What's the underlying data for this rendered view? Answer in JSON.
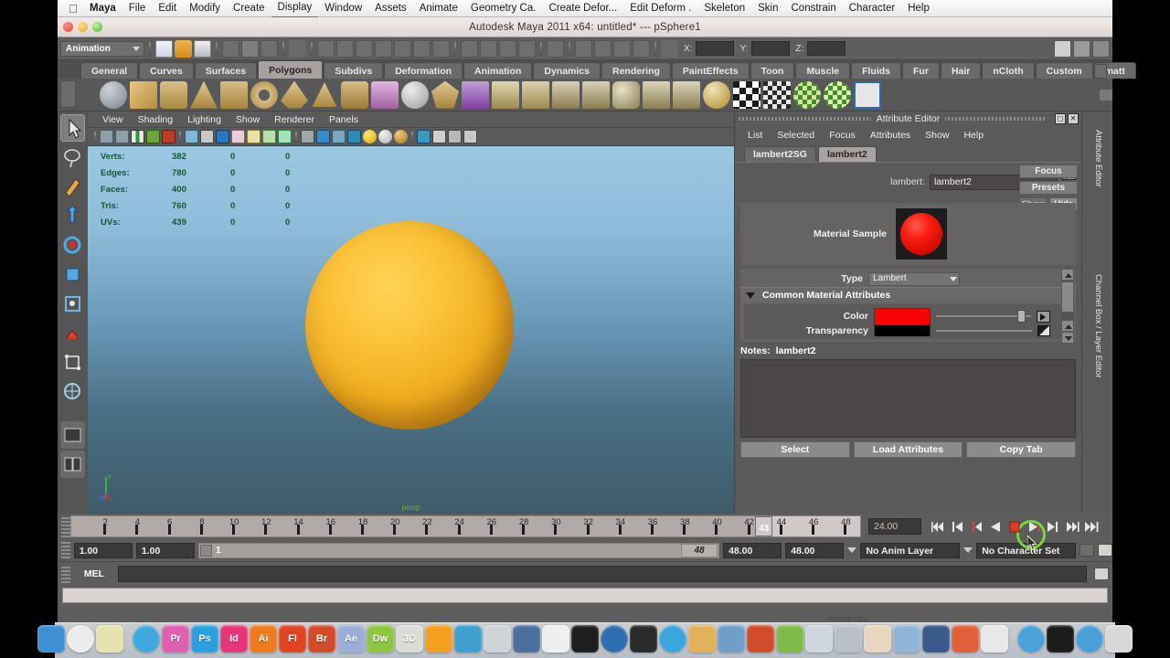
{
  "os_menubar": {
    "apple_icon": "apple-icon",
    "items": [
      {
        "label": "Maya",
        "bold": true,
        "active": false
      },
      {
        "label": "File",
        "bold": false,
        "active": false
      },
      {
        "label": "Edit",
        "bold": false,
        "active": false
      },
      {
        "label": "Modify",
        "bold": false,
        "active": false
      },
      {
        "label": "Create",
        "bold": false,
        "active": false
      },
      {
        "label": "Display",
        "bold": false,
        "active": true
      },
      {
        "label": "Window",
        "bold": false,
        "active": false
      },
      {
        "label": "Assets",
        "bold": false,
        "active": false
      },
      {
        "label": "Animate",
        "bold": false,
        "active": false
      },
      {
        "label": "Geometry Ca.",
        "bold": false,
        "active": false
      },
      {
        "label": "Create Defor...",
        "bold": false,
        "active": false
      },
      {
        "label": "Edit Deform .",
        "bold": false,
        "active": false
      },
      {
        "label": "Skeleton",
        "bold": false,
        "active": false
      },
      {
        "label": "Skin",
        "bold": false,
        "active": false
      },
      {
        "label": "Constrain",
        "bold": false,
        "active": false
      },
      {
        "label": "Character",
        "bold": false,
        "active": false
      },
      {
        "label": "Help",
        "bold": false,
        "active": false
      }
    ]
  },
  "title_bar": {
    "title": "Autodesk Maya 2011 x64: untitled*  ---  pSphere1"
  },
  "status_line": {
    "menu_set": "Animation",
    "x_label": "X:",
    "y_label": "Y:",
    "z_label": "Z:",
    "x_value": "",
    "y_value": "",
    "z_value": ""
  },
  "shelf": {
    "tabs": [
      "General",
      "Curves",
      "Surfaces",
      "Polygons",
      "Subdivs",
      "Deformation",
      "Animation",
      "Dynamics",
      "Rendering",
      "PaintEffects",
      "Toon",
      "Muscle",
      "Fluids",
      "Fur",
      "Hair",
      "nCloth",
      "Custom",
      "matt"
    ],
    "selected_tab": "Polygons"
  },
  "viewport": {
    "menus": [
      "View",
      "Shading",
      "Lighting",
      "Show",
      "Renderer",
      "Panels"
    ],
    "hud": {
      "rows": [
        {
          "label": "Verts:",
          "total": "382",
          "b": "0",
          "c": "0"
        },
        {
          "label": "Edges:",
          "total": "780",
          "b": "0",
          "c": "0"
        },
        {
          "label": "Faces:",
          "total": "400",
          "b": "0",
          "c": "0"
        },
        {
          "label": "Tris:",
          "total": "760",
          "b": "0",
          "c": "0"
        },
        {
          "label": "UVs:",
          "total": "439",
          "b": "0",
          "c": "0"
        }
      ]
    },
    "axis_labels": {
      "y": "y",
      "x": "x",
      "z": "z"
    },
    "camera_label": "persp"
  },
  "attribute_editor": {
    "title": "Attribute Editor",
    "menus": [
      "List",
      "Selected",
      "Focus",
      "Attributes",
      "Show",
      "Help"
    ],
    "tabs": [
      "lambert2SG",
      "lambert2"
    ],
    "selected_tab": "lambert2",
    "name_label": "lambert:",
    "name_value": "lambert2",
    "buttons": {
      "focus": "Focus",
      "presets": "Presets",
      "show": "Show",
      "hide": "Hide"
    },
    "material_sample_label": "Material Sample",
    "material_sample_color": "#fb1c10",
    "type_label": "Type",
    "type_value": "Lambert",
    "section_title": "Common Material Attributes",
    "attributes": [
      {
        "label": "Color",
        "color": "#ff0000"
      },
      {
        "label": "Transparency",
        "color": "#000000"
      }
    ],
    "notes_label": "Notes:",
    "notes_value": "lambert2",
    "notes_text": "",
    "footer_buttons": [
      "Select",
      "Load Attributes",
      "Copy Tab"
    ]
  },
  "right_panel": {
    "label_top": "Attribute Editor",
    "label_bottom": "Channel Box / Layer Editor"
  },
  "time_slider": {
    "ticks": [
      2,
      4,
      6,
      8,
      10,
      12,
      14,
      16,
      18,
      20,
      22,
      24,
      26,
      28,
      30,
      32,
      34,
      36,
      38,
      40,
      42,
      44,
      46,
      48
    ],
    "current_frame": "43",
    "frame_field": "24.00",
    "playback_buttons": [
      "go-to-start-icon",
      "step-back-frame-icon",
      "step-back-key-icon",
      "play-backwards-icon",
      "stop-icon",
      "play-forwards-icon",
      "step-forward-key-icon",
      "step-forward-frame-icon",
      "go-to-end-icon"
    ],
    "active_button": "stop-icon"
  },
  "range_slider": {
    "start_field": "1.00",
    "anim_start_field": "1.00",
    "range_start_label": "1",
    "range_end_label": "48",
    "anim_end_field": "48.00",
    "end_field": "48.00",
    "anim_layer": "No Anim Layer",
    "character_set": "No Character Set"
  },
  "command_line": {
    "label": "MEL",
    "value": ""
  },
  "help_line": {
    "value": ""
  },
  "dock": {
    "user_label": "Alexandru",
    "items": [
      {
        "name": "finder-icon",
        "color": "#3e8fd4",
        "letter": ""
      },
      {
        "name": "launchpad-icon",
        "color": "#ececec",
        "letter": ""
      },
      {
        "name": "notes-icon",
        "color": "#e6e2b0",
        "letter": ""
      },
      {
        "name": "safari-icon",
        "color": "#3fa8dd",
        "letter": ""
      },
      {
        "name": "premiere-icon",
        "color": "#e060b0",
        "letter": "Pr"
      },
      {
        "name": "photoshop-icon",
        "color": "#2aa0e0",
        "letter": "Ps"
      },
      {
        "name": "indesign-icon",
        "color": "#e8357a",
        "letter": "Id"
      },
      {
        "name": "illustrator-icon",
        "color": "#f07a1c",
        "letter": "Ai"
      },
      {
        "name": "flash-icon",
        "color": "#e04420",
        "letter": "Fl"
      },
      {
        "name": "bridge-icon",
        "color": "#d64a2a",
        "letter": "Br"
      },
      {
        "name": "aftereffects-icon",
        "color": "#9aaed8",
        "letter": "Ae"
      },
      {
        "name": "dreamweaver-icon",
        "color": "#8ec63f",
        "letter": "Dw"
      },
      {
        "name": "3d-icon",
        "color": "#dcdcd4",
        "letter": "3D"
      },
      {
        "name": "sketch-icon",
        "color": "#f2a01e",
        "letter": ""
      },
      {
        "name": "photos-icon",
        "color": "#3e9fd0",
        "letter": ""
      },
      {
        "name": "paint-icon",
        "color": "#cfd4d8",
        "letter": ""
      },
      {
        "name": "download-icon",
        "color": "#4a6f9c",
        "letter": ""
      },
      {
        "name": "calendar-icon",
        "color": "#efefef",
        "letter": ""
      },
      {
        "name": "hand-icon",
        "color": "#1e1e1e",
        "letter": ""
      },
      {
        "name": "globe-icon",
        "color": "#2f6fb0",
        "letter": ""
      },
      {
        "name": "skull-icon",
        "color": "#2a2a2a",
        "letter": ""
      },
      {
        "name": "itunes-icon",
        "color": "#3aa6dd",
        "letter": ""
      },
      {
        "name": "folder-icon",
        "color": "#e2b25a",
        "letter": ""
      },
      {
        "name": "maya-icon",
        "color": "#6f9fc9",
        "letter": ""
      },
      {
        "name": "tool-icon",
        "color": "#d24c2c",
        "letter": ""
      },
      {
        "name": "app-icon-1",
        "color": "#7fbb4a",
        "letter": ""
      },
      {
        "name": "app-icon-2",
        "color": "#d0d6de",
        "letter": ""
      },
      {
        "name": "app-icon-3",
        "color": "#b7bfc9",
        "letter": ""
      },
      {
        "name": "app-icon-4",
        "color": "#e8d7c0",
        "letter": ""
      },
      {
        "name": "app-icon-5",
        "color": "#8fb6d8",
        "letter": ""
      },
      {
        "name": "app-icon-6",
        "color": "#3a5a8c",
        "letter": ""
      },
      {
        "name": "skype-icon",
        "color": "#e0603a",
        "letter": ""
      },
      {
        "name": "chart-icon",
        "color": "#e8e8e8",
        "letter": ""
      },
      {
        "name": "messenger-icon",
        "color": "#4aa2d8",
        "letter": ""
      },
      {
        "name": "terminal-icon",
        "color": "#1c1c1c",
        "letter": ""
      },
      {
        "name": "spotlight-icon",
        "color": "#4ba0d8",
        "letter": ""
      },
      {
        "name": "trash-icon",
        "color": "#d8d8d8",
        "letter": ""
      }
    ]
  }
}
